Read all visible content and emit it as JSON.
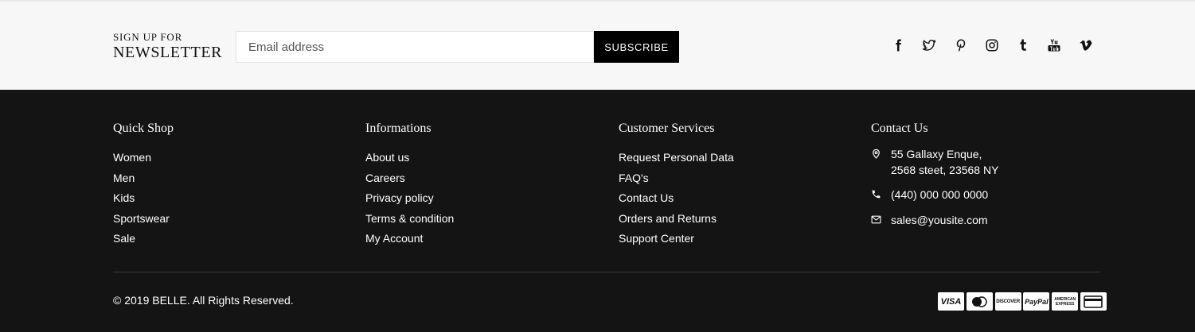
{
  "newsletter": {
    "label_small": "SIGN UP FOR",
    "label_big": "NEWSLETTER",
    "placeholder": "Email address",
    "button": "SUBSCRIBE"
  },
  "social": [
    "facebook-icon",
    "twitter-icon",
    "pinterest-icon",
    "instagram-icon",
    "tumblr-icon",
    "youtube-icon",
    "vimeo-icon"
  ],
  "columns": {
    "quick_shop": {
      "title": "Quick Shop",
      "items": [
        "Women",
        "Men",
        "Kids",
        "Sportswear",
        "Sale"
      ]
    },
    "informations": {
      "title": "Informations",
      "items": [
        "About us",
        "Careers",
        "Privacy policy",
        "Terms & condition",
        "My Account"
      ]
    },
    "customer_services": {
      "title": "Customer Services",
      "items": [
        "Request Personal Data",
        "FAQ's",
        "Contact Us",
        "Orders and Returns",
        "Support Center"
      ]
    },
    "contact": {
      "title": "Contact Us",
      "address_line1": "55 Gallaxy Enque,",
      "address_line2": "2568 steet, 23568 NY",
      "phone": "(440) 000 000 0000",
      "email": "sales@yousite.com"
    }
  },
  "copyright": "© 2019 BELLE. All Rights Reserved.",
  "payments": {
    "visa": "VISA",
    "discover": "DISCOVER",
    "paypal": "PayPal",
    "amex": "AMERICAN EXPRESS"
  },
  "colors": {
    "footer_bg": "#141414",
    "newsletter_bg": "#f7f7f7",
    "button_bg": "#000000",
    "text_light": "#ffffff"
  }
}
